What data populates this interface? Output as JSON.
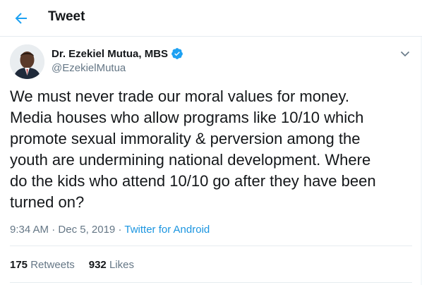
{
  "header": {
    "title": "Tweet",
    "back_icon": "arrow-left-icon"
  },
  "author": {
    "name": "Dr. Ezekiel Mutua, MBS",
    "handle": "@EzekielMutua",
    "verified": true,
    "verified_icon": "verified-badge-icon"
  },
  "tweet": {
    "text": "We must never trade our moral values for money.\nMedia houses who allow programs like 10/10 which\npromote sexual immorality & perversion among the\nyouth are undermining national development. Where\ndo the kids who attend 10/10 go after they have been\nturned on?",
    "time": "9:34 AM",
    "separator": "·",
    "date": "Dec 5, 2019",
    "source": "Twitter for Android"
  },
  "stats": {
    "retweets_count": "175",
    "retweets_label": "Retweets",
    "likes_count": "932",
    "likes_label": "Likes"
  },
  "colors": {
    "accent": "#1da1f2",
    "text": "#14171a",
    "secondary": "#657786"
  }
}
